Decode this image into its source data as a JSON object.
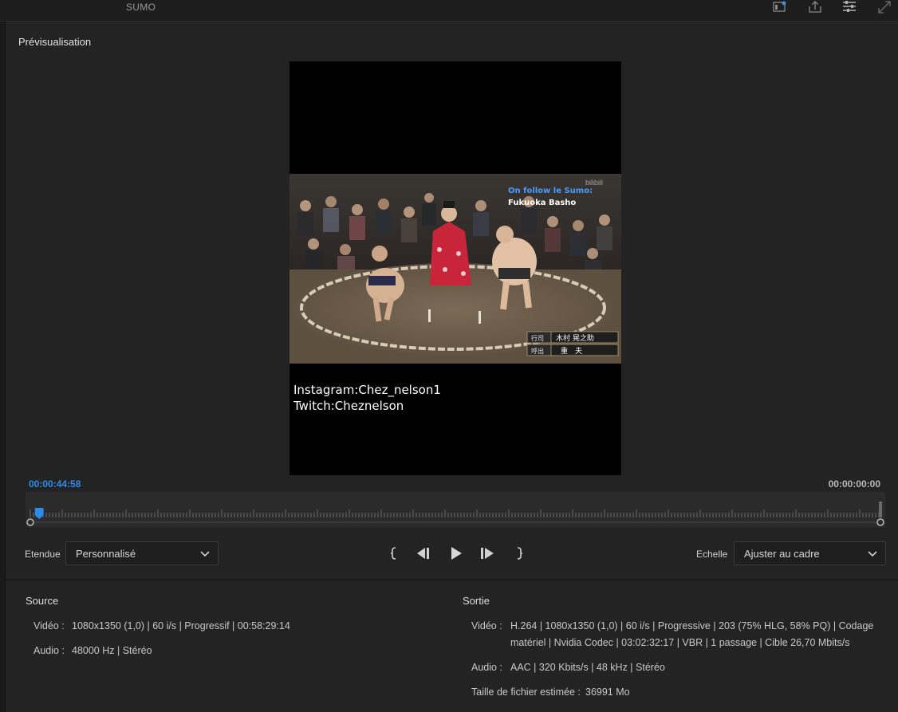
{
  "app": {
    "title": "SUMO"
  },
  "panel": {
    "title": "Prévisualisation"
  },
  "video": {
    "overlay_line1": "On follow le Sumo:",
    "overlay_line2": "Fukuoka Basho",
    "watermark": "bilibili",
    "caption_line1": "Instagram:Chez_nelson1",
    "caption_line2": "Twitch:Cheznelson",
    "jp_label1_key": "行司",
    "jp_label1_val": "木村 晃之助",
    "jp_label2_key": "呼出",
    "jp_label2_val": "重　夫"
  },
  "timeline": {
    "current_time": "00:00:44:58",
    "end_time": "00:00:00:00",
    "playhead_fraction": 0.01
  },
  "controls": {
    "range_label": "Etendue",
    "range_value": "Personnalisé",
    "scale_label": "Echelle",
    "scale_value": "Ajuster au cadre"
  },
  "source": {
    "title": "Source",
    "video_label": "Vidéo :",
    "video_value": "1080x1350 (1,0) | 60 i/s | Progressif | 00:58:29:14",
    "audio_label": "Audio :",
    "audio_value": "48000 Hz | Stéréo"
  },
  "output": {
    "title": "Sortie",
    "video_label": "Vidéo :",
    "video_line1": "H.264 | 1080x1350 (1,0) | 60 i/s | Progressive | 203 (75% HLG, 58% PQ) | Codage",
    "video_line2": "matériel | Nvidia Codec | 03:02:32:17  | VBR | 1 passage | Cible 26,70 Mbits/s",
    "audio_label": "Audio :",
    "audio_value": "AAC | 320 Kbits/s | 48 kHz | Stéréo",
    "size_label": "Taille de fichier estimée :",
    "size_value": "36991 Mo"
  },
  "colors": {
    "background": "#232323",
    "accent_blue": "#2d8ceb",
    "overlay_blue": "#4a9cff"
  },
  "icons": [
    "panel-icon",
    "export-icon",
    "settings-icon",
    "expand-icon",
    "mark-in-icon",
    "step-back-icon",
    "play-icon",
    "step-forward-icon",
    "mark-out-icon",
    "chevron-down-icon"
  ]
}
